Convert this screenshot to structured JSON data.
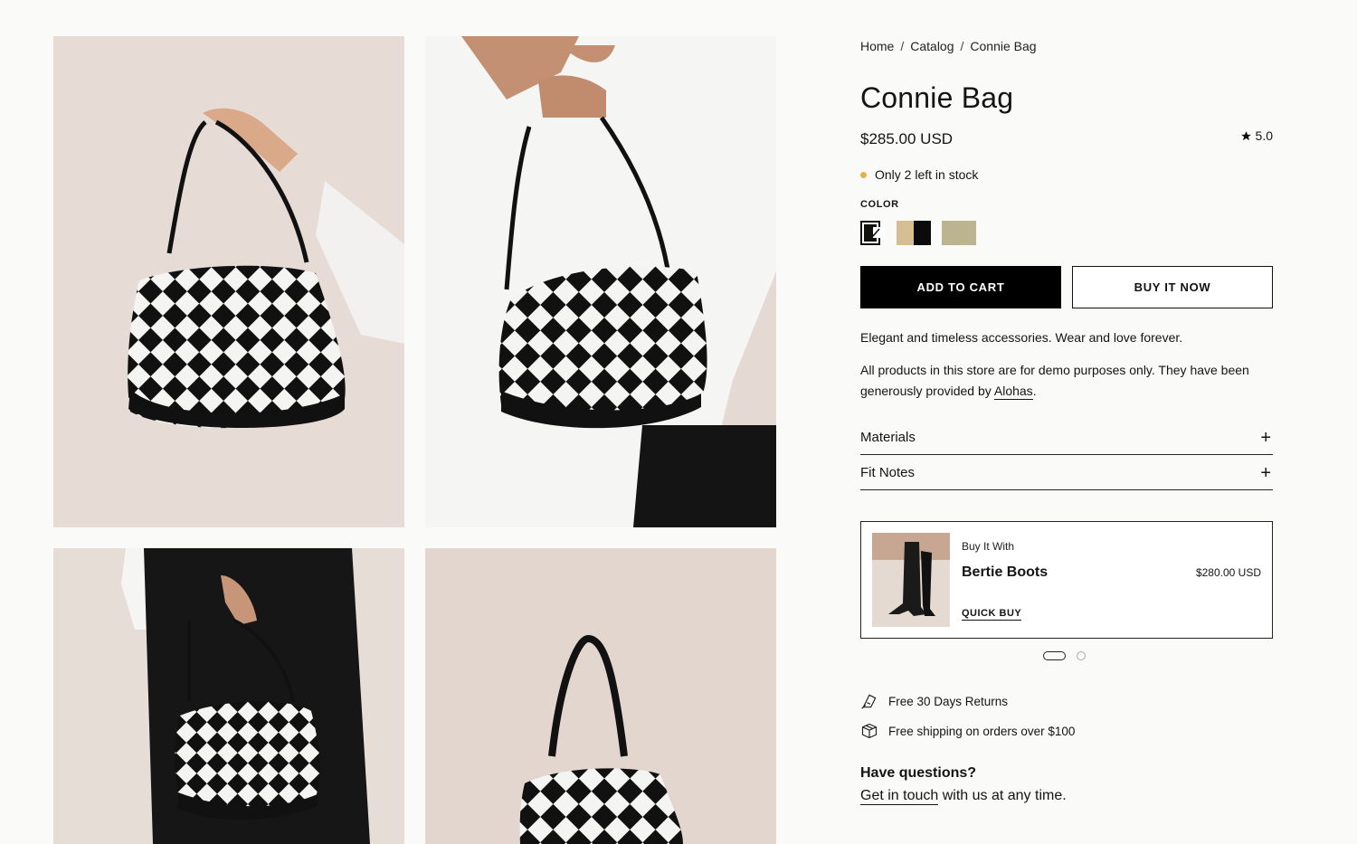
{
  "breadcrumb": {
    "home": "Home",
    "catalog": "Catalog",
    "current": "Connie Bag",
    "separator": "/"
  },
  "product": {
    "title": "Connie Bag",
    "price": "$285.00 USD",
    "rating": "5.0",
    "stock": "Only 2 left in stock",
    "stock_dot_color": "#e6b04a"
  },
  "color": {
    "label": "COLOR",
    "swatches": [
      {
        "name": "black-white",
        "colors": [
          "#111111",
          "#ffffff"
        ],
        "selected": true
      },
      {
        "name": "beige-black",
        "colors": [
          "#d6bd92",
          "#0b0b0b"
        ],
        "selected": false
      },
      {
        "name": "olive",
        "colors": [
          "#bcb48e"
        ],
        "selected": false
      }
    ]
  },
  "actions": {
    "add_to_cart": "ADD TO CART",
    "buy_now": "BUY IT NOW"
  },
  "description": {
    "line1": "Elegant and timeless accessories. Wear and love forever.",
    "line2_prefix": "All products in this store are for demo purposes only. They have been generously provided by ",
    "line2_link": "Alohas",
    "line2_suffix": "."
  },
  "accordions": [
    {
      "label": "Materials",
      "icon": "plus-icon"
    },
    {
      "label": "Fit Notes",
      "icon": "plus-icon"
    }
  ],
  "upsell": {
    "label": "Buy It With",
    "name": "Bertie Boots",
    "price": "$280.00 USD",
    "quick_buy": "QUICK BUY"
  },
  "carousel": {
    "pages": 2,
    "active": 1
  },
  "features": [
    {
      "icon": "return-tag-icon",
      "label": "Free 30 Days Returns"
    },
    {
      "icon": "box-icon",
      "label": "Free shipping on orders over $100"
    }
  ],
  "questions": {
    "title": "Have questions?",
    "link": "Get in touch",
    "suffix": " with us at any time."
  },
  "colors": {
    "background": "#fafaf9",
    "photo_bg": "#e5dcd6",
    "primary": "#000000"
  }
}
